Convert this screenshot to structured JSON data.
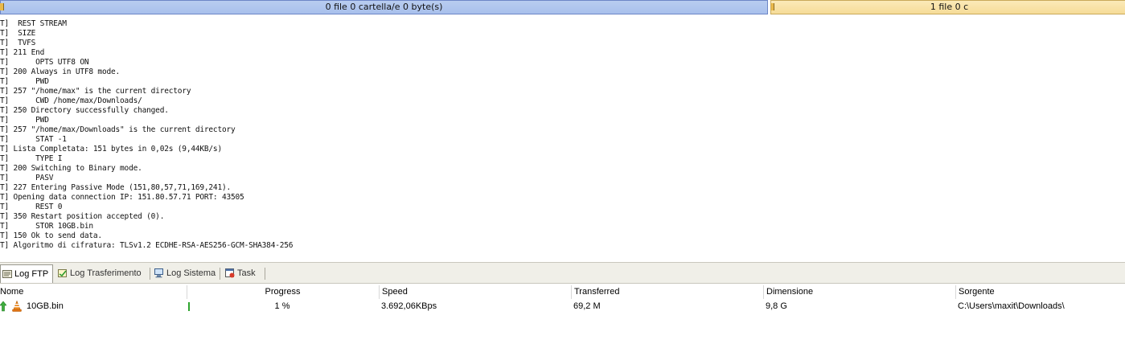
{
  "status": {
    "left_text": "0 file 0 cartella/e 0 byte(s)",
    "right_text": "1 file 0 c"
  },
  "log": {
    "lines": [
      "T]  REST STREAM",
      "T]  SIZE",
      "T]  TVFS",
      "T] 211 End",
      "T]      OPTS UTF8 ON",
      "T] 200 Always in UTF8 mode.",
      "T]      PWD",
      "T] 257 \"/home/max\" is the current directory",
      "T]      CWD /home/max/Downloads/",
      "T] 250 Directory successfully changed.",
      "T]      PWD",
      "T] 257 \"/home/max/Downloads\" is the current directory",
      "T]      STAT -1",
      "T] Lista Completata: 151 bytes in 0,02s (9,44KB/s)",
      "T]      TYPE I",
      "T] 200 Switching to Binary mode.",
      "T]      PASV",
      "T] 227 Entering Passive Mode (151,80,57,71,169,241).",
      "T] Opening data connection IP: 151.80.57.71 PORT: 43505",
      "T]      REST 0",
      "T] 350 Restart position accepted (0).",
      "T]      STOR 10GB.bin",
      "T] 150 Ok to send data.",
      "T] Algoritmo di cifratura: TLSv1.2 ECDHE-RSA-AES256-GCM-SHA384-256"
    ]
  },
  "tabs": [
    {
      "label": "Log FTP",
      "icon": "log-ftp-icon",
      "active": true
    },
    {
      "label": "Log Trasferimento",
      "icon": "transfer-log-icon",
      "active": false
    },
    {
      "label": "Log Sistema",
      "icon": "system-log-icon",
      "active": false
    },
    {
      "label": "Task",
      "icon": "task-icon",
      "active": false
    }
  ],
  "queue": {
    "headers": {
      "name": "Nome",
      "progress": "Progress",
      "speed": "Speed",
      "transferred": "Transferred",
      "size": "Dimensione",
      "source": "Sorgente"
    },
    "rows": [
      {
        "name": "10GB.bin",
        "progress": "1 %",
        "progress_fraction": 0.01,
        "speed": "3.692,06KBps",
        "transferred": "69,2 M",
        "size": "9,8 G",
        "source": "C:\\Users\\maxit\\Downloads\\",
        "direction_icon": "upload-arrow-icon",
        "file_icon": "vlc-cone-icon"
      }
    ]
  },
  "colors": {
    "status_left_bg": "#b9cdf0",
    "status_right_bg": "#fbeab8",
    "progress_green": "#2fa52f"
  }
}
